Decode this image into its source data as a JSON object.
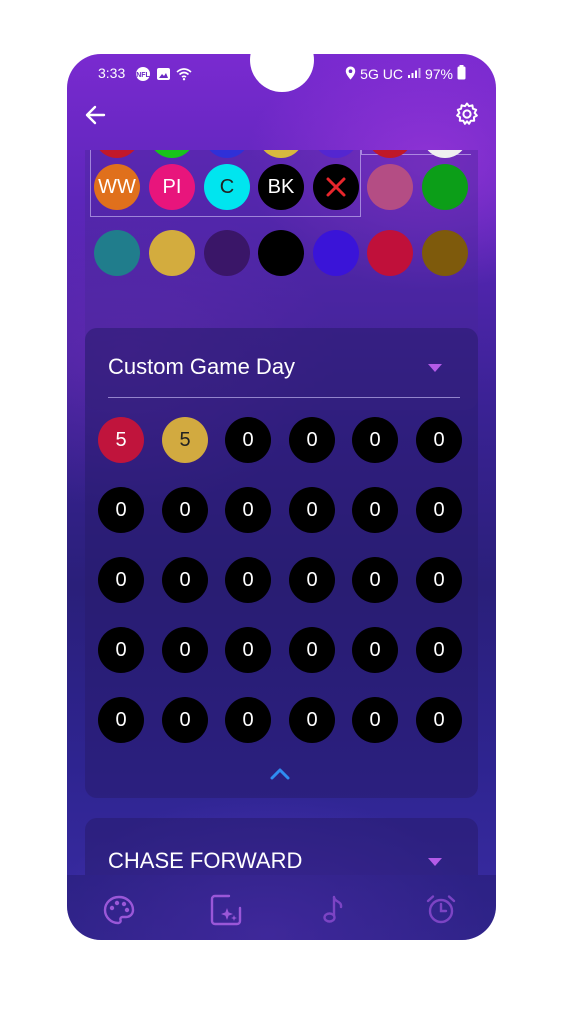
{
  "status_bar": {
    "time": "3:33",
    "network": "5G UC",
    "battery": "97%",
    "left_icons": [
      "sports-app-icon",
      "gallery-icon",
      "wifi-icon"
    ],
    "right_icons": [
      "location-icon",
      "signal-icon",
      "battery-icon"
    ]
  },
  "header": {
    "back_icon": "arrow-left-icon",
    "settings_icon": "gear-icon"
  },
  "palette": {
    "labeled_colors": [
      {
        "label": "WW",
        "color": "#e0701c"
      },
      {
        "label": "PI",
        "color": "#e8157c"
      },
      {
        "label": "C",
        "color": "#00e5ef",
        "text_color": "#222222"
      },
      {
        "label": "BK",
        "color": "#000000"
      },
      {
        "label": "",
        "color": "#000000",
        "icon": "close-x-icon",
        "icon_color": "#e8262c"
      }
    ],
    "extra_colors_row2": [
      "#b44d84",
      "#0c9e18"
    ],
    "row3_colors": [
      "#207d8c",
      "#d3ac3e",
      "#3a1668",
      "#000000",
      "#3a14d8",
      "#c0103a",
      "#7e5a0c"
    ],
    "top_row_colors": [
      "#c2182a",
      "#18c41a",
      "#2f30d8",
      "#d8b83e",
      "#5426d0",
      "#c01828",
      "#f0f0f0"
    ]
  },
  "custom_game_day": {
    "title": "Custom Game Day",
    "grid": [
      [
        {
          "v": "5",
          "c": "#c0143c"
        },
        {
          "v": "5",
          "c": "#d2aa40",
          "t": "#222222"
        },
        {
          "v": "0"
        },
        {
          "v": "0"
        },
        {
          "v": "0"
        },
        {
          "v": "0"
        }
      ],
      [
        {
          "v": "0"
        },
        {
          "v": "0"
        },
        {
          "v": "0"
        },
        {
          "v": "0"
        },
        {
          "v": "0"
        },
        {
          "v": "0"
        }
      ],
      [
        {
          "v": "0"
        },
        {
          "v": "0"
        },
        {
          "v": "0"
        },
        {
          "v": "0"
        },
        {
          "v": "0"
        },
        {
          "v": "0"
        }
      ],
      [
        {
          "v": "0"
        },
        {
          "v": "0"
        },
        {
          "v": "0"
        },
        {
          "v": "0"
        },
        {
          "v": "0"
        },
        {
          "v": "0"
        }
      ],
      [
        {
          "v": "0"
        },
        {
          "v": "0"
        },
        {
          "v": "0"
        },
        {
          "v": "0"
        },
        {
          "v": "0"
        },
        {
          "v": "0"
        }
      ]
    ],
    "collapse_icon": "chevron-up-icon"
  },
  "chase_forward": {
    "title": "CHASE FORWARD"
  },
  "bottom_nav": [
    {
      "name": "palette-icon"
    },
    {
      "name": "image-sparkle-icon"
    },
    {
      "name": "music-note-icon"
    },
    {
      "name": "alarm-clock-icon"
    }
  ],
  "colors": {
    "accent_arrow": "#b45be8",
    "chevron": "#2f8cf2",
    "nav_icon": "#9a57d8"
  }
}
